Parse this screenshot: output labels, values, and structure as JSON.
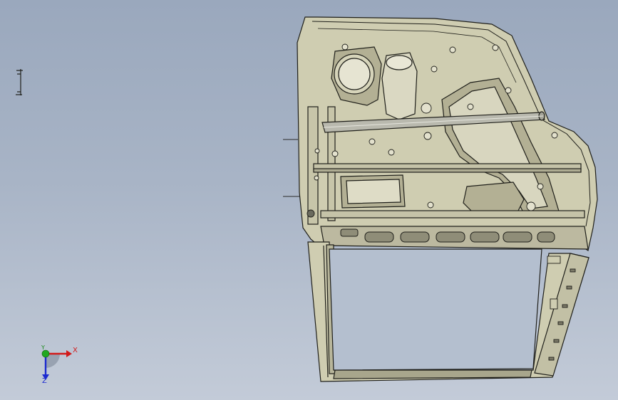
{
  "viewport": {
    "background_top": "#9aa8bd",
    "background_bottom": "#c3cbd8"
  },
  "model": {
    "part_fill": "#cfcdb1",
    "part_stroke": "#1f1f1a",
    "shadow_fill": "#b3b094",
    "bar_fill": "#b9b9ae"
  },
  "triad": {
    "x_label": "X",
    "y_label": "Y",
    "z_label": "Z",
    "x_color": "#d21a1a",
    "y_color": "#1a8a1a",
    "z_color": "#1c2ad0",
    "icons": [
      "x-axis-arrow-icon",
      "y-axis-point-icon",
      "z-axis-arrow-icon"
    ]
  },
  "markers": {
    "icons": [
      "floating-bracket-icon"
    ]
  }
}
